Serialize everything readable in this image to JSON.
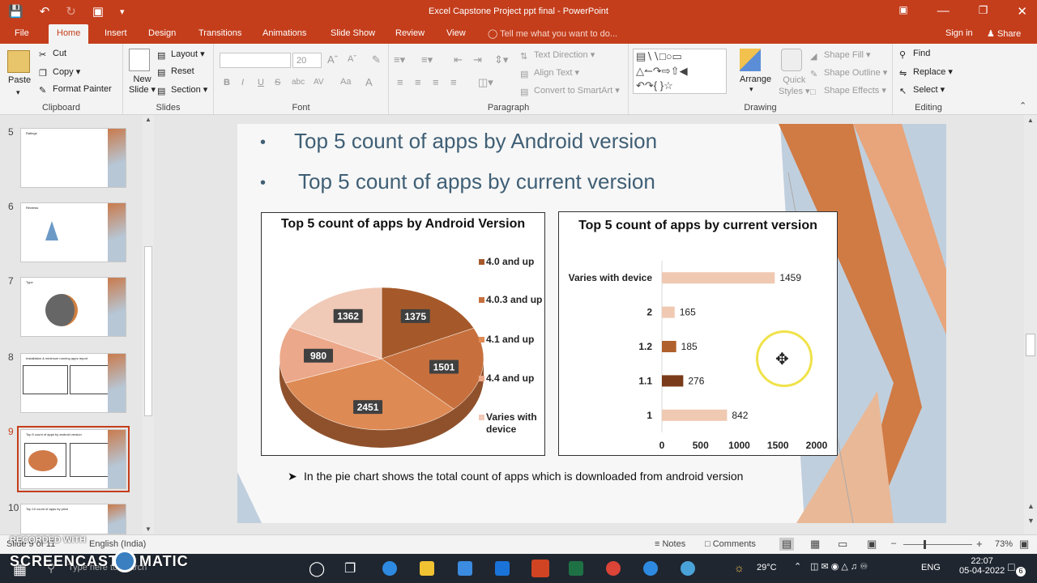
{
  "titlebar": {
    "title": "Excel Capstone Project ppt final  -  PowerPoint"
  },
  "menu": {
    "tabs": [
      "File",
      "Home",
      "Insert",
      "Design",
      "Transitions",
      "Animations",
      "Slide Show",
      "Review",
      "View"
    ],
    "tell_me": "Tell me what you want to do...",
    "sign_in": "Sign in",
    "share": "Share"
  },
  "ribbon": {
    "clipboard": {
      "paste": "Paste",
      "cut": "Cut",
      "copy": "Copy",
      "format_painter": "Format Painter",
      "label": "Clipboard"
    },
    "slides": {
      "new_slide_1": "New",
      "new_slide_2": "Slide",
      "layout": "Layout",
      "reset": "Reset",
      "section": "Section",
      "label": "Slides"
    },
    "font": {
      "size": "20",
      "bold": "B",
      "italic": "I",
      "underline": "U",
      "strike": "S",
      "shadow": "abc",
      "spacing": "AV",
      "case": "Aa",
      "clear": "A",
      "color": "A",
      "label": "Font"
    },
    "paragraph": {
      "text_direction": "Text Direction",
      "align_text": "Align Text",
      "convert": "Convert to SmartArt",
      "label": "Paragraph"
    },
    "drawing": {
      "arrange": "Arrange",
      "quick_1": "Quick",
      "quick_2": "Styles",
      "shape_fill": "Shape Fill",
      "shape_outline": "Shape Outline",
      "shape_effects": "Shape Effects",
      "label": "Drawing"
    },
    "editing": {
      "find": "Find",
      "replace": "Replace",
      "select": "Select",
      "label": "Editing"
    }
  },
  "thumbnails": [
    {
      "num": "5",
      "title": "Ratings"
    },
    {
      "num": "6",
      "title": "Reviews"
    },
    {
      "num": "7",
      "title": "Type"
    },
    {
      "num": "8",
      "title": "Installation & minimum running apps report"
    },
    {
      "num": "9",
      "title": "Top 5 count of apps by android version"
    },
    {
      "num": "10",
      "title": "Top 10 count of apps by price"
    }
  ],
  "slide": {
    "bullets": [
      "Top 5 count of apps by Android version",
      "Top 5 count of apps by current version"
    ],
    "note": "In the pie chart shows the total count of apps which is downloaded from android version"
  },
  "chart_data": [
    {
      "type": "pie",
      "title": "Top 5 count of apps by Android Version",
      "categories": [
        "4.0 and up",
        "4.0.3 and up",
        "4.1 and up",
        "4.4 and up",
        "Varies with device"
      ],
      "values": [
        1375,
        1501,
        2451,
        980,
        1362
      ],
      "colors": [
        "#a5592a",
        "#c7703d",
        "#de8a54",
        "#eca88a",
        "#f0c9b7"
      ]
    },
    {
      "type": "bar",
      "title": "Top 5 count of apps by current version",
      "orientation": "horizontal",
      "categories": [
        "Varies with device",
        "2",
        "1.2",
        "1.1",
        "1"
      ],
      "values": [
        1459,
        165,
        185,
        276,
        842
      ],
      "colors": [
        "#f0c9b2",
        "#f0c9b2",
        "#b0602c",
        "#7a3b1a",
        "#f0c9b2"
      ],
      "xlim": [
        0,
        2000
      ],
      "xticks": [
        "0",
        "500",
        "1000",
        "1500",
        "2000"
      ]
    }
  ],
  "statusbar": {
    "slide": "Slide 9 of 11",
    "lang": "English (India)",
    "notes": "Notes",
    "comments": "Comments",
    "zoom": "73%"
  },
  "taskbar": {
    "search": "Type here to search",
    "weather": "29°C",
    "lang": "ENG",
    "time": "22:07",
    "date": "05-04-2022",
    "badge": "6"
  },
  "watermark": {
    "line1": "RECORDED WITH",
    "line2": "SCREENCAST",
    "line3": "MATIC"
  }
}
